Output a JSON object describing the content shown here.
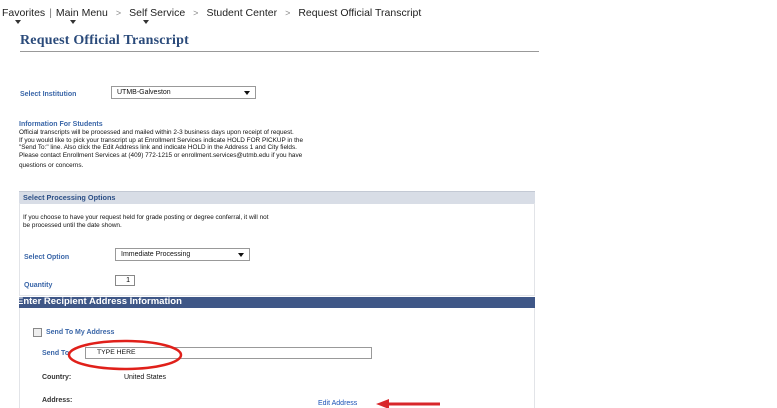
{
  "breadcrumb": {
    "items": [
      "Favorites",
      "Main Menu",
      "Self Service",
      "Student Center",
      "Request Official Transcript"
    ]
  },
  "page": {
    "title": "Request Official Transcript"
  },
  "institution": {
    "label": "Select Institution",
    "value": "UTMB-Galveston"
  },
  "info": {
    "heading": "Information For Students",
    "lines": [
      "Official transcripts will be processed and mailed within 2-3 business days upon receipt of request.",
      "If you would like to pick your transcript up at Enrollment Services indicate HOLD FOR PICKUP in the",
      "\"Send To:\" line. Also click the Edit Address link and indicate HOLD in the Address 1 and City fields.",
      "Please contact Enrollment Services at (409) 772-1215 or enrollment.services@utmb.edu if you have",
      "questions or concerns."
    ]
  },
  "processing": {
    "section_title": "Select Processing Options",
    "note_line1": "If you choose to have your request held for grade posting or degree conferral, it will not",
    "note_line2": "be processed until the date shown.",
    "option_label": "Select Option",
    "option_value": "Immediate Processing",
    "quantity_label": "Quantity",
    "quantity_value": "1"
  },
  "recipient": {
    "section_title": "Enter Recipient Address Information",
    "send_to_my_address": "Send To My Address",
    "send_to_label": "Send To",
    "send_to_value": "TYPE HERE",
    "country_label": "Country:",
    "country_value": "United States",
    "address_label": "Address:",
    "edit_address": "Edit Address"
  },
  "annotations": {
    "circle_color": "#e0201a",
    "arrow_color": "#d8262a"
  }
}
